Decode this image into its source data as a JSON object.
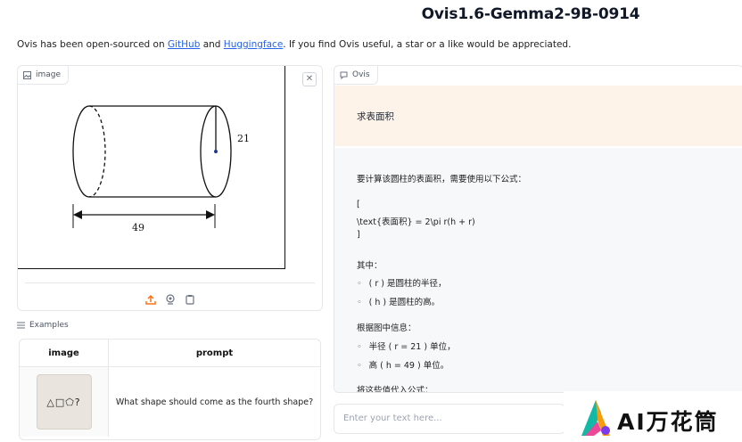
{
  "page": {
    "title": "Ovis1.6-Gemma2-9B-0914",
    "intro": {
      "before": "Ovis has been open-sourced on ",
      "link1": "GitHub",
      "middle": " and ",
      "link2": "Huggingface",
      "after": ". If you find Ovis useful, a star or a like would be appreciated."
    }
  },
  "image_panel": {
    "label": "image",
    "figure": {
      "radius_label": "21",
      "length_label": "49"
    }
  },
  "examples": {
    "label": "Examples",
    "headers": [
      "image",
      "prompt"
    ],
    "rows": [
      {
        "thumb_text": "△□⬠?",
        "prompt": "What shape should come as the fourth shape?"
      }
    ]
  },
  "chat": {
    "label": "Ovis",
    "user_message": "求表面积",
    "bot_lines": {
      "l1": "要计算该圆柱的表面积，需要使用以下公式：",
      "l2": "[",
      "l3": "\\text{表面积} = 2\\pi r(h + r)",
      "l4": "]",
      "l5": "其中：",
      "l6": "( r ) 是圆柱的半径，",
      "l7": "( h ) 是圆柱的高。",
      "l8": "根据图中信息：",
      "l9": "半径 ( r = 21 ) 单位，",
      "l10": "高 ( h = 49 ) 单位。",
      "l11": "将这些值代入公式："
    },
    "input_placeholder": "Enter your text here..."
  },
  "watermark": {
    "text": "AI万花筒"
  }
}
